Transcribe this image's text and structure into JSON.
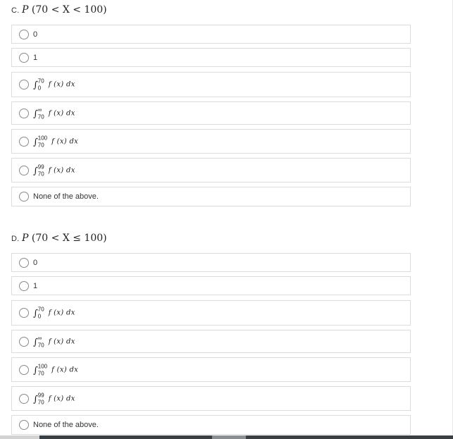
{
  "questions": [
    {
      "letter": "C.",
      "title_expr": "P",
      "title_args": "(70 < X < 100)",
      "options": [
        {
          "type": "text",
          "label": "0"
        },
        {
          "type": "text",
          "label": "1"
        },
        {
          "type": "integral",
          "symbol": "∫",
          "upper": "70",
          "lower": "0",
          "integrand": "f (x) dx"
        },
        {
          "type": "integral",
          "symbol": "∫",
          "upper": "∞",
          "lower": "70",
          "integrand": "f (x) dx"
        },
        {
          "type": "integral",
          "symbol": "∫",
          "upper": "100",
          "lower": "70",
          "integrand": "f (x) dx"
        },
        {
          "type": "integral",
          "symbol": "∫",
          "upper": "99",
          "lower": "70",
          "integrand": "f (x) dx"
        },
        {
          "type": "text",
          "label": "None of the above."
        }
      ]
    },
    {
      "letter": "D.",
      "title_expr": "P",
      "title_args": "(70 < X ≤ 100)",
      "options": [
        {
          "type": "text",
          "label": "0"
        },
        {
          "type": "text",
          "label": "1"
        },
        {
          "type": "integral",
          "symbol": "∫",
          "upper": "70",
          "lower": "0",
          "integrand": "f (x) dx"
        },
        {
          "type": "integral",
          "symbol": "∫",
          "upper": "∞",
          "lower": "70",
          "integrand": "f (x) dx"
        },
        {
          "type": "integral",
          "symbol": "∫",
          "upper": "100",
          "lower": "70",
          "integrand": "f (x) dx"
        },
        {
          "type": "integral",
          "symbol": "∫",
          "upper": "99",
          "lower": "70",
          "integrand": "f (x) dx"
        },
        {
          "type": "text",
          "label": "None of the above."
        }
      ]
    }
  ]
}
